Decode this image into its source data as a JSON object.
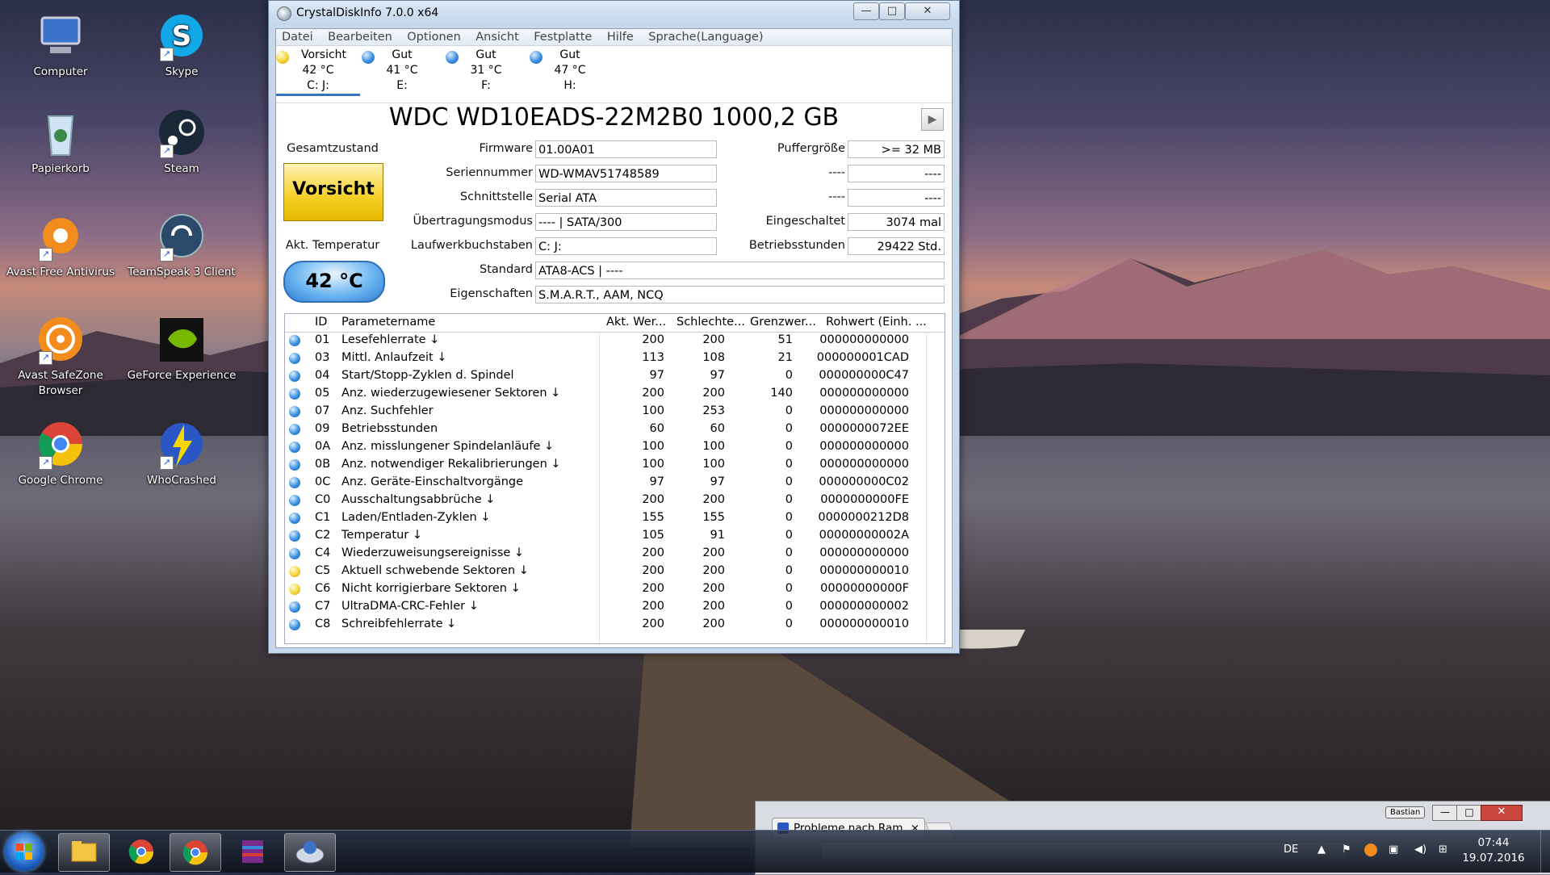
{
  "desktop": {
    "icons": [
      {
        "label": "Computer"
      },
      {
        "label": "Skype"
      },
      {
        "label": "Papierkorb"
      },
      {
        "label": "Steam"
      },
      {
        "label": "Avast Free Antivirus"
      },
      {
        "label": "TeamSpeak 3 Client"
      },
      {
        "label": "Avast SafeZone Browser"
      },
      {
        "label": "GeForce Experience"
      },
      {
        "label": "Google Chrome"
      },
      {
        "label": "WhoCrashed"
      }
    ]
  },
  "window": {
    "title": "CrystalDiskInfo 7.0.0 x64",
    "menu": [
      "Datei",
      "Bearbeiten",
      "Optionen",
      "Ansicht",
      "Festplatte",
      "Hilfe",
      "Sprache(Language)"
    ],
    "disks": [
      {
        "status": "Vorsicht",
        "temp": "42 °C",
        "drive": "C: J:",
        "color": "#f3d63a"
      },
      {
        "status": "Gut",
        "temp": "41 °C",
        "drive": "E:",
        "color": "#3b8fe0"
      },
      {
        "status": "Gut",
        "temp": "31 °C",
        "drive": "F:",
        "color": "#3b8fe0"
      },
      {
        "status": "Gut",
        "temp": "47 °C",
        "drive": "H:",
        "color": "#3b8fe0"
      }
    ],
    "model": "WDC WD10EADS-22M2B0 1000,2 GB",
    "health_label": "Gesamtzustand",
    "health_value": "Vorsicht",
    "temp_label": "Akt. Temperatur",
    "temp_value": "42 °C",
    "info": {
      "firmware_label": "Firmware",
      "firmware": "01.00A01",
      "serial_label": "Seriennummer",
      "serial": "WD-WMAV51748589",
      "interface_label": "Schnittstelle",
      "interface": "Serial ATA",
      "transfer_label": "Übertragungsmodus",
      "transfer": "---- | SATA/300",
      "drive_label": "Laufwerkbuchstaben",
      "drive": "C: J:",
      "standard_label": "Standard",
      "standard": "ATA8-ACS | ----",
      "features_label": "Eigenschaften",
      "features": "S.M.A.R.T., AAM, NCQ",
      "buffer_label": "Puffergröße",
      "buffer": ">= 32 MB",
      "blank1_label": "----",
      "blank1": "----",
      "blank2_label": "----",
      "blank2": "----",
      "poweron_count_label": "Eingeschaltet",
      "poweron_count": "3074 mal",
      "poweron_hours_label": "Betriebsstunden",
      "poweron_hours": "29422 Std."
    },
    "table": {
      "headers": [
        "ID",
        "Parametername",
        "Akt. Wer...",
        "Schlechte...",
        "Grenzwer...",
        "Rohwert (Einh. ..."
      ],
      "rows": [
        {
          "id": "01",
          "name": "Lesefehlerrate ↓",
          "cur": "200",
          "worst": "200",
          "thr": "51",
          "raw": "000000000000",
          "status": "blue"
        },
        {
          "id": "03",
          "name": "Mittl. Anlaufzeit ↓",
          "cur": "113",
          "worst": "108",
          "thr": "21",
          "raw": "000000001CAD",
          "status": "blue"
        },
        {
          "id": "04",
          "name": "Start/Stopp-Zyklen d. Spindel",
          "cur": "97",
          "worst": "97",
          "thr": "0",
          "raw": "000000000C47",
          "status": "blue"
        },
        {
          "id": "05",
          "name": "Anz. wiederzugewiesener Sektoren ↓",
          "cur": "200",
          "worst": "200",
          "thr": "140",
          "raw": "000000000000",
          "status": "blue"
        },
        {
          "id": "07",
          "name": "Anz. Suchfehler",
          "cur": "100",
          "worst": "253",
          "thr": "0",
          "raw": "000000000000",
          "status": "blue"
        },
        {
          "id": "09",
          "name": "Betriebsstunden",
          "cur": "60",
          "worst": "60",
          "thr": "0",
          "raw": "0000000072EE",
          "status": "blue"
        },
        {
          "id": "0A",
          "name": "Anz. misslungener Spindelanläufe ↓",
          "cur": "100",
          "worst": "100",
          "thr": "0",
          "raw": "000000000000",
          "status": "blue"
        },
        {
          "id": "0B",
          "name": "Anz. notwendiger Rekalibrierungen ↓",
          "cur": "100",
          "worst": "100",
          "thr": "0",
          "raw": "000000000000",
          "status": "blue"
        },
        {
          "id": "0C",
          "name": "Anz. Geräte-Einschaltvorgänge",
          "cur": "97",
          "worst": "97",
          "thr": "0",
          "raw": "000000000C02",
          "status": "blue"
        },
        {
          "id": "C0",
          "name": "Ausschaltungsabbrüche ↓",
          "cur": "200",
          "worst": "200",
          "thr": "0",
          "raw": "0000000000FE",
          "status": "blue"
        },
        {
          "id": "C1",
          "name": "Laden/Entladen-Zyklen ↓",
          "cur": "155",
          "worst": "155",
          "thr": "0",
          "raw": "0000000212D8",
          "status": "blue"
        },
        {
          "id": "C2",
          "name": "Temperatur ↓",
          "cur": "105",
          "worst": "91",
          "thr": "0",
          "raw": "00000000002A",
          "status": "blue"
        },
        {
          "id": "C4",
          "name": "Wiederzuweisungsereignisse ↓",
          "cur": "200",
          "worst": "200",
          "thr": "0",
          "raw": "000000000000",
          "status": "blue"
        },
        {
          "id": "C5",
          "name": "Aktuell schwebende Sektoren ↓",
          "cur": "200",
          "worst": "200",
          "thr": "0",
          "raw": "000000000010",
          "status": "yellow"
        },
        {
          "id": "C6",
          "name": "Nicht korrigierbare Sektoren ↓",
          "cur": "200",
          "worst": "200",
          "thr": "0",
          "raw": "00000000000F",
          "status": "yellow"
        },
        {
          "id": "C7",
          "name": "UltraDMA-CRC-Fehler ↓",
          "cur": "200",
          "worst": "200",
          "thr": "0",
          "raw": "000000000002",
          "status": "blue"
        },
        {
          "id": "C8",
          "name": "Schreibfehlerrate ↓",
          "cur": "200",
          "worst": "200",
          "thr": "0",
          "raw": "000000000010",
          "status": "blue"
        }
      ]
    }
  },
  "browser": {
    "tab_title": "Probleme nach Ram",
    "profile": "Bastian"
  },
  "taskbar": {
    "language": "DE",
    "time": "07:44",
    "date": "19.07.2016"
  }
}
